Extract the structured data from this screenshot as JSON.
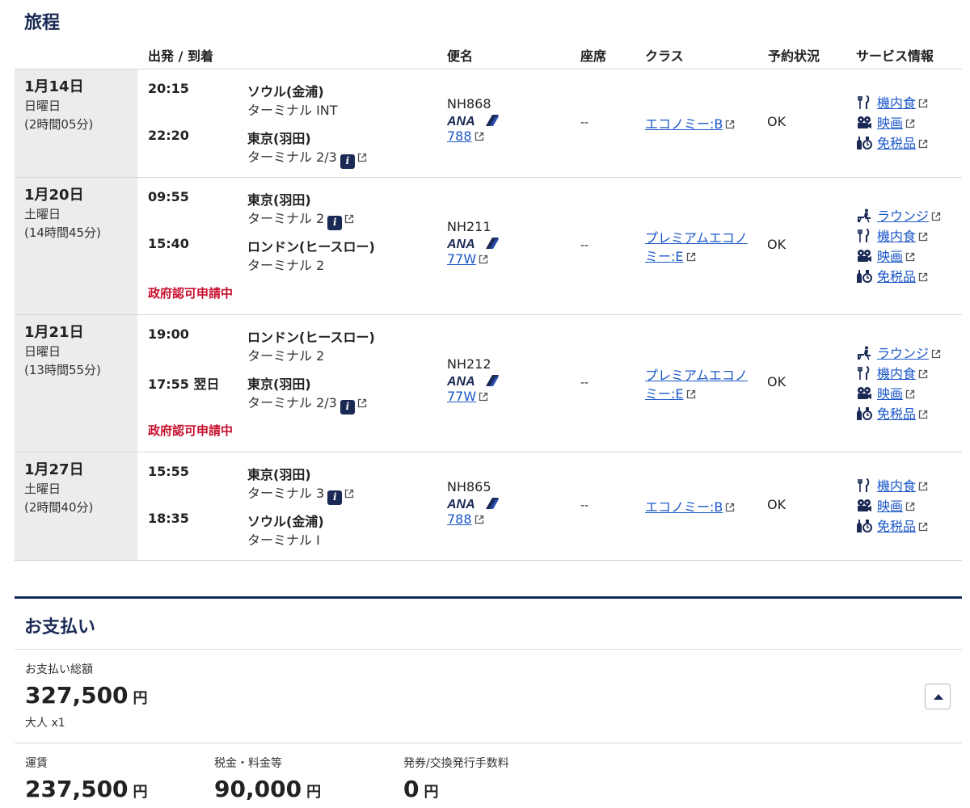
{
  "itinerary": {
    "title": "旅程",
    "headers": {
      "dep_arr": "出発 / 到着",
      "flight": "便名",
      "seat": "座席",
      "class": "クラス",
      "status": "予約状況",
      "service": "サービス情報"
    },
    "segments": [
      {
        "date": "1月14日",
        "weekday": "日曜日",
        "duration": "(2時間05分)",
        "dep_time": "20:15",
        "dep_city": "ソウル(金浦)",
        "dep_terminal": "ターミナル INT",
        "arr_time": "22:20",
        "arr_city": "東京(羽田)",
        "arr_terminal": "ターミナル 2/3",
        "flight_no": "NH868",
        "aircraft": "788",
        "seat": "--",
        "class_line1": "エコノミー:B",
        "class_line2": "",
        "status": "OK",
        "note": "",
        "services": [
          "機内食",
          "映画",
          "免税品"
        ]
      },
      {
        "date": "1月20日",
        "weekday": "土曜日",
        "duration": "(14時間45分)",
        "dep_time": "09:55",
        "dep_city": "東京(羽田)",
        "dep_terminal": "ターミナル 2",
        "arr_time": "15:40",
        "arr_city": "ロンドン(ヒースロー)",
        "arr_terminal": "ターミナル 2",
        "flight_no": "NH211",
        "aircraft": "77W",
        "seat": "--",
        "class_line1": "プレミアムエコノ",
        "class_line2": "ミー:E",
        "status": "OK",
        "note": "政府認可申請中",
        "services": [
          "ラウンジ",
          "機内食",
          "映画",
          "免税品"
        ]
      },
      {
        "date": "1月21日",
        "weekday": "日曜日",
        "duration": "(13時間55分)",
        "dep_time": "19:00",
        "dep_city": "ロンドン(ヒースロー)",
        "dep_terminal": "ターミナル 2",
        "arr_time": "17:55 翌日",
        "arr_city": "東京(羽田)",
        "arr_terminal": "ターミナル 2/3",
        "flight_no": "NH212",
        "aircraft": "77W",
        "seat": "--",
        "class_line1": "プレミアムエコノ",
        "class_line2": "ミー:E",
        "status": "OK",
        "note": "政府認可申請中",
        "services": [
          "ラウンジ",
          "機内食",
          "映画",
          "免税品"
        ]
      },
      {
        "date": "1月27日",
        "weekday": "土曜日",
        "duration": "(2時間40分)",
        "dep_time": "15:55",
        "dep_city": "東京(羽田)",
        "dep_terminal": "ターミナル 3",
        "arr_time": "18:35",
        "arr_city": "ソウル(金浦)",
        "arr_terminal": "ターミナル I",
        "flight_no": "NH865",
        "aircraft": "788",
        "seat": "--",
        "class_line1": "エコノミー:B",
        "class_line2": "",
        "status": "OK",
        "note": "",
        "services": [
          "機内食",
          "映画",
          "免税品"
        ]
      }
    ]
  },
  "payment": {
    "title": "お支払い",
    "total_label": "お支払い総額",
    "total_amount": "327,500",
    "currency": "円",
    "passengers": "大人 x1",
    "fare_label": "運賃",
    "fare_amount": "237,500",
    "tax_label": "税金・料金等",
    "tax_amount": "90,000",
    "fee_label": "発券/交換発行手数料",
    "fee_amount": "0"
  },
  "colors": {
    "navy": "#1a2a55",
    "link": "#1a56c8",
    "warning": "#c8102e",
    "date_bg": "#ececec"
  },
  "icons": {
    "meal": "fork-knife-icon",
    "movie": "film-reel-icon",
    "dutyfree": "bottle-icon",
    "lounge": "lounge-chair-icon",
    "info": "info-icon",
    "external": "external-link-icon"
  }
}
